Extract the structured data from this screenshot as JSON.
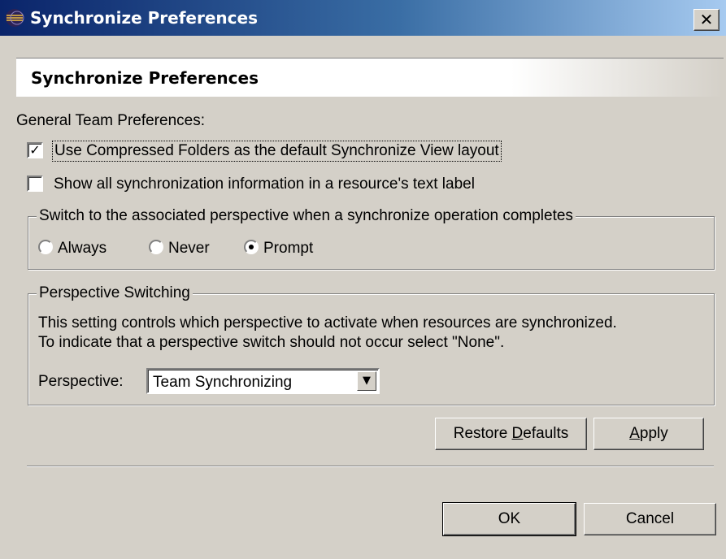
{
  "window": {
    "title": "Synchronize Preferences"
  },
  "header": {
    "title": "Synchronize Preferences"
  },
  "general": {
    "label": "General Team Preferences:",
    "compressed_label": "Use Compressed Folders as the default Synchronize View layout",
    "compressed_checked": true,
    "show_all_label": "Show all synchronization information in a resource's text label",
    "show_all_checked": false
  },
  "switch_group": {
    "legend": "Switch to the associated perspective when a synchronize operation completes",
    "options": [
      "Always",
      "Never",
      "Prompt"
    ],
    "selected": "Prompt"
  },
  "perspective_group": {
    "legend": "Perspective Switching",
    "desc1": "This setting controls which perspective to activate when resources are synchronized.",
    "desc2": "To indicate that a perspective switch should not occur select \"None\".",
    "perspective_label": "Perspective:",
    "perspective_value": "Team Synchronizing"
  },
  "buttons": {
    "restore_pre": "Restore ",
    "restore_mn": "D",
    "restore_post": "efaults",
    "apply_mn": "A",
    "apply_post": "pply",
    "ok": "OK",
    "cancel": "Cancel"
  },
  "icons": {
    "title": "eclipse-icon",
    "close": "close-icon",
    "check": "checkmark-icon",
    "dropdown": "dropdown-arrow-icon"
  },
  "colors": {
    "title_start": "#0a246a",
    "title_end": "#a6caf0",
    "dialog_bg": "#d4d0c8"
  }
}
